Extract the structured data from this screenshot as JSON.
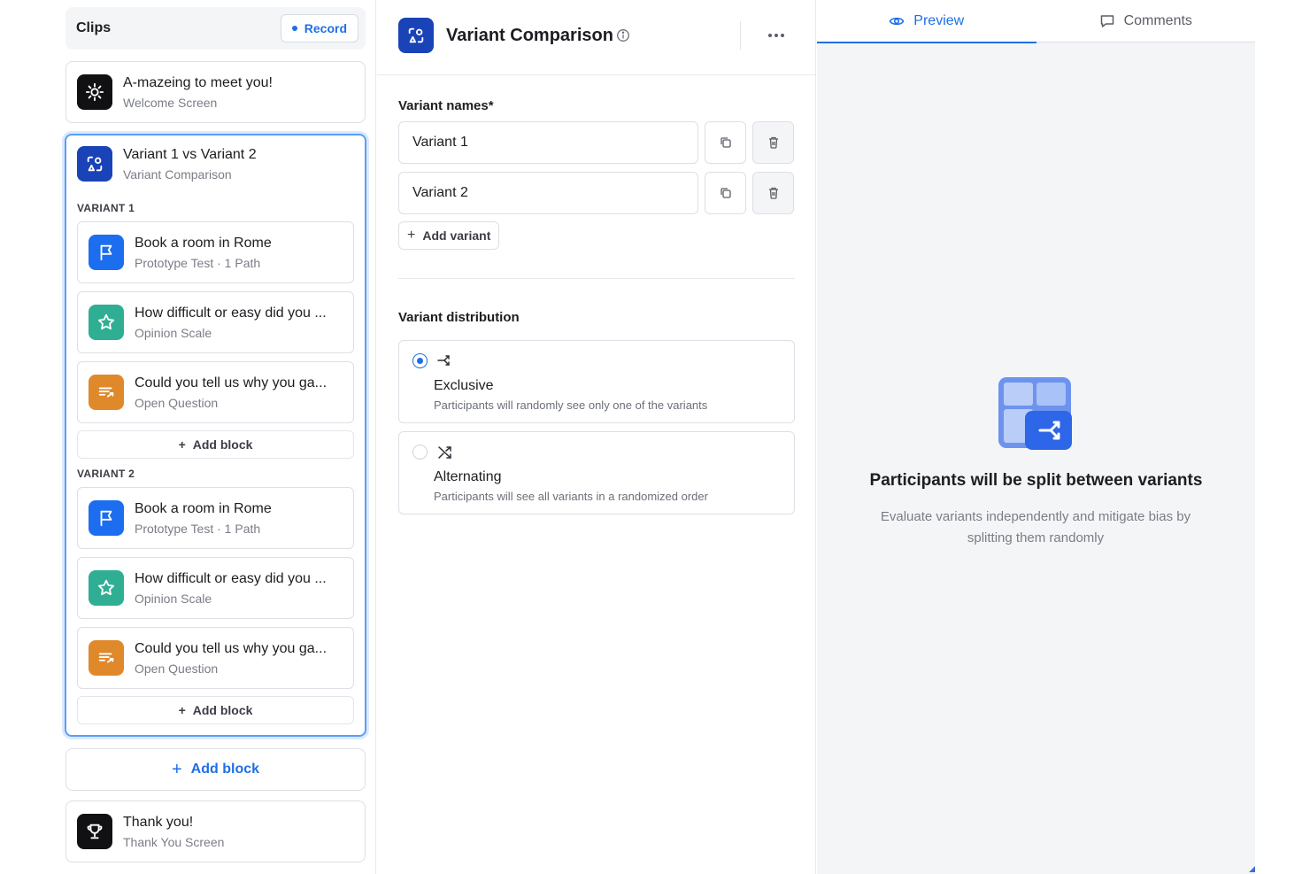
{
  "clips": {
    "title": "Clips",
    "record_label": "Record"
  },
  "welcome": {
    "title": "A-mazeing to meet you!",
    "subtitle": "Welcome Screen"
  },
  "comparison_group": {
    "title": "Variant 1 vs Variant 2",
    "subtitle": "Variant Comparison",
    "variant1": {
      "label": "VARIANT 1",
      "blocks": [
        {
          "title": "Book a room in Rome",
          "subtitle": "Prototype Test · 1 Path",
          "icon": "flag-icon",
          "color": "#1c6df0"
        },
        {
          "title": "How difficult or easy did you ...",
          "subtitle": "Opinion Scale",
          "icon": "star-icon",
          "color": "#2fae94"
        },
        {
          "title": "Could you tell us why you ga...",
          "subtitle": "Open Question",
          "icon": "text-lines-icon",
          "color": "#e0892b"
        }
      ],
      "add_block": "Add block"
    },
    "variant2": {
      "label": "VARIANT 2",
      "blocks": [
        {
          "title": "Book a room in Rome",
          "subtitle": "Prototype Test · 1 Path",
          "icon": "flag-icon",
          "color": "#1c6df0"
        },
        {
          "title": "How difficult or easy did you ...",
          "subtitle": "Opinion Scale",
          "icon": "star-icon",
          "color": "#2fae94"
        },
        {
          "title": "Could you tell us why you ga...",
          "subtitle": "Open Question",
          "icon": "text-lines-icon",
          "color": "#e0892b"
        }
      ],
      "add_block": "Add block"
    }
  },
  "add_block_main": "Add block",
  "thankyou": {
    "title": "Thank you!",
    "subtitle": "Thank You Screen"
  },
  "editor": {
    "title": "Variant Comparison",
    "variant_names_label": "Variant names*",
    "variants": [
      "Variant 1",
      "Variant 2"
    ],
    "add_variant": "Add variant",
    "distribution_label": "Variant distribution",
    "options": [
      {
        "title": "Exclusive",
        "desc": "Participants will randomly see only one of the variants",
        "selected": true
      },
      {
        "title": "Alternating",
        "desc": "Participants will see all variants in a randomized order",
        "selected": false
      }
    ]
  },
  "preview": {
    "tabs": [
      "Preview",
      "Comments"
    ],
    "empty_title": "Participants will be split between variants",
    "empty_desc": "Evaluate variants independently and mitigate bias by splitting them randomly"
  },
  "colors": {
    "accent": "#1f6fe5",
    "variant_icon": "#1a43b8",
    "prototype": "#1c6df0",
    "opinion": "#2fae94",
    "open_question": "#e0892b"
  }
}
